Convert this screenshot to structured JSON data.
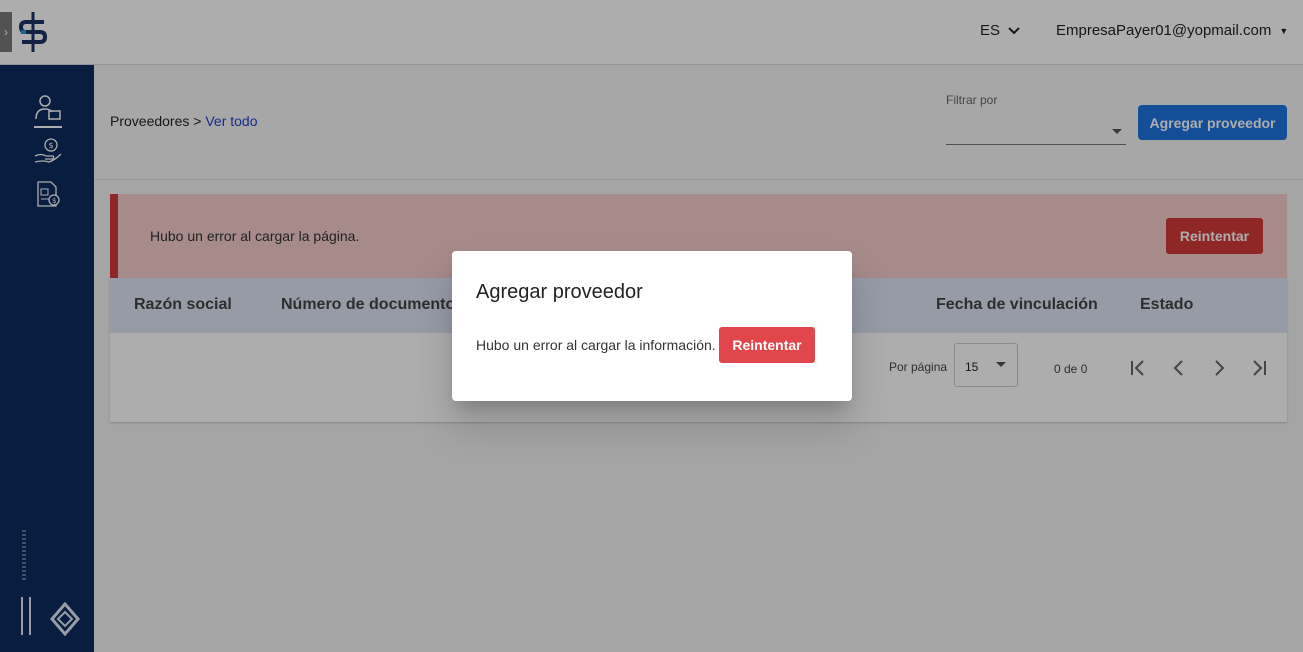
{
  "header": {
    "language": "ES",
    "user_email": "EmpresaPayer01@yopmail.com"
  },
  "sidebar": {
    "items": [
      {
        "icon": "supplier-person-icon",
        "active": true
      },
      {
        "icon": "hand-money-icon",
        "active": false
      },
      {
        "icon": "invoice-document-icon",
        "active": false
      }
    ]
  },
  "page": {
    "breadcrumb_root": "Proveedores >",
    "breadcrumb_current": "Ver todo",
    "filter_label": "Filtrar por",
    "filter_value": "",
    "add_button": "Agregar proveedor"
  },
  "error_banner": {
    "message": "Hubo un error al cargar la página.",
    "retry_label": "Reintentar"
  },
  "table": {
    "headers": [
      "Razón social",
      "Número de documento",
      "Fecha de vinculación",
      "Estado"
    ],
    "per_page_label": "Por página",
    "per_page_value": "15",
    "range": "0 de 0"
  },
  "dialog": {
    "title": "Agregar proveedor",
    "message": "Hubo un error al cargar la información.",
    "retry_label": "Reintentar"
  },
  "colors": {
    "sidebar": "#0d2c5e",
    "primary": "#1f73e0",
    "danger": "#d43a3a",
    "table_header": "#dfe5f5"
  }
}
